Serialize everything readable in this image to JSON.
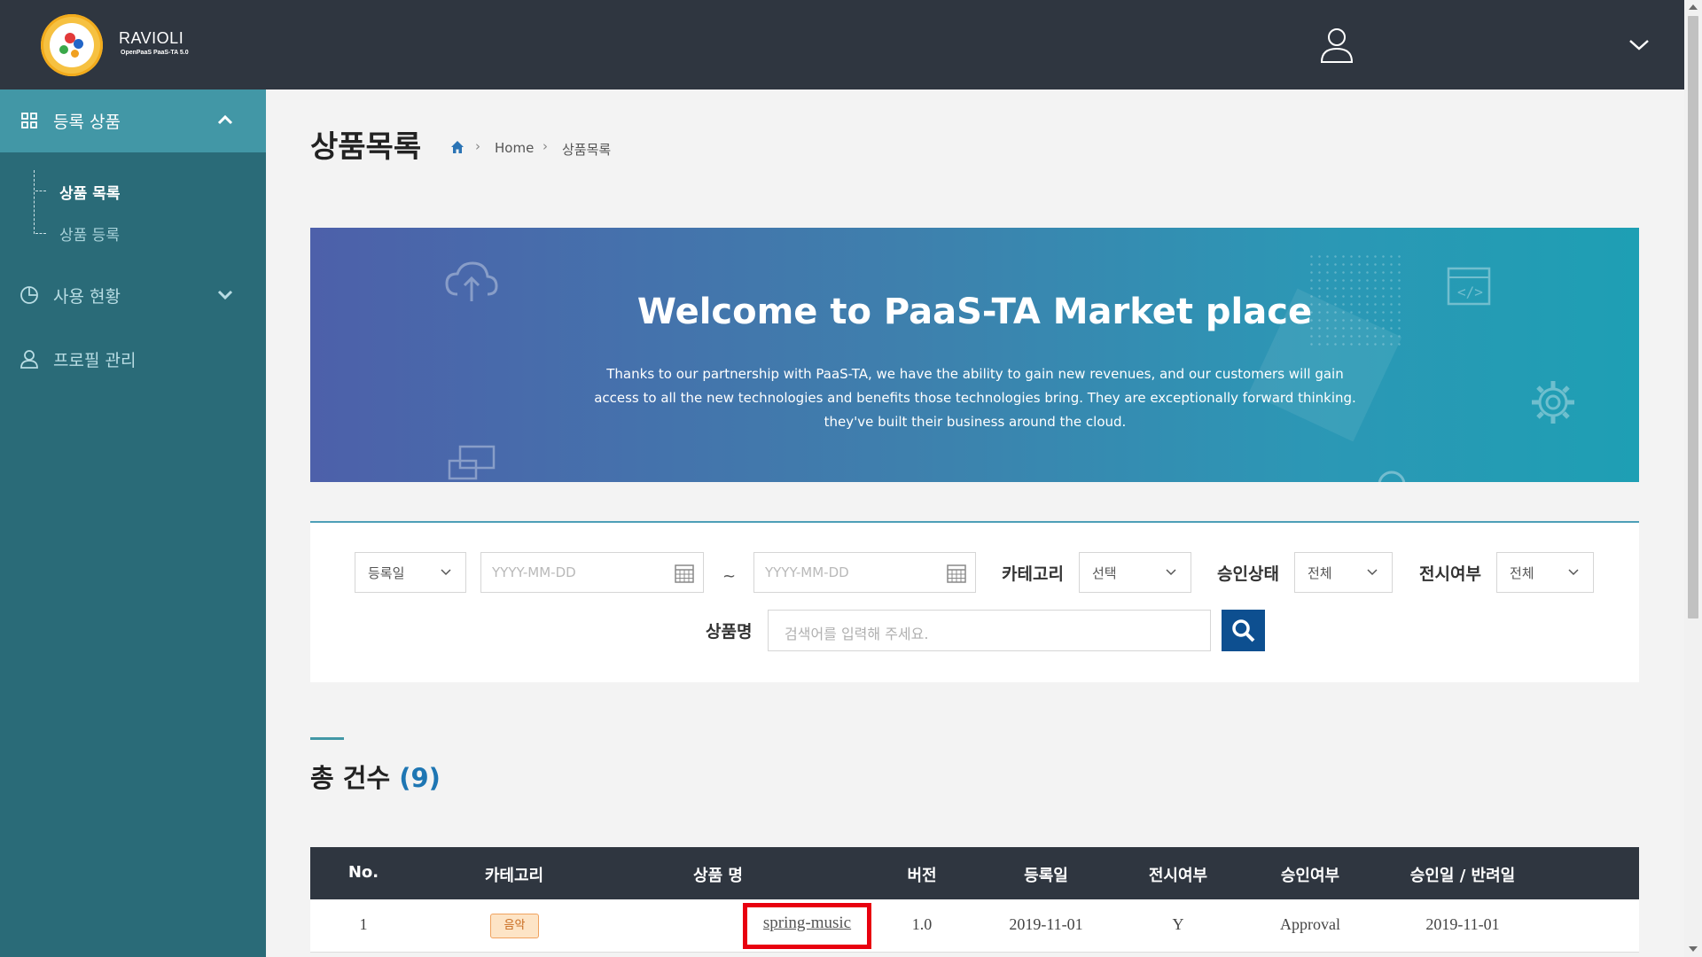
{
  "app": {
    "logo_text": "RAVIOLI",
    "logo_sub": "OpenPaaS PaaS-TA 5.0"
  },
  "sidebar": {
    "sections": [
      {
        "label": "등록 상품",
        "expanded": true,
        "icon": "grid-icon"
      },
      {
        "label": "사용 현황",
        "expanded": false,
        "icon": "chart-pie-icon"
      },
      {
        "label": "프로필 관리",
        "icon": "user-icon"
      }
    ],
    "sub_items": [
      {
        "label": "상품 목록",
        "active": true
      },
      {
        "label": "상품 등록",
        "active": false
      }
    ]
  },
  "header": {
    "title": "상품목록",
    "breadcrumb": [
      "Home",
      "상품목록"
    ]
  },
  "banner": {
    "title": "Welcome to PaaS-TA Market place",
    "lines": [
      "Thanks to our partnership with PaaS-TA, we have the ability to gain new revenues, and our customers will gain",
      "access to all the new technologies and benefits those technologies bring. They are exceptionally forward thinking.",
      "they've built their business around the cloud."
    ]
  },
  "search": {
    "date_type": "등록일",
    "date_from_placeholder": "YYYY-MM-DD",
    "tilde": "~",
    "date_to_placeholder": "YYYY-MM-DD",
    "category_label": "카테고리",
    "category_value": "선택",
    "approval_label": "승인상태",
    "approval_value": "전체",
    "display_label": "전시여부",
    "display_value": "전체",
    "name_label": "상품명",
    "name_placeholder": "검색어를 입력해 주세요."
  },
  "summary": {
    "label": "총 건수",
    "count": "(9)"
  },
  "table": {
    "columns": [
      "No.",
      "카테고리",
      "상품 명",
      "버전",
      "등록일",
      "전시여부",
      "승인여부",
      "승인일 / 반려일"
    ],
    "rows": [
      {
        "no": "1",
        "category": "음악",
        "name": "spring-music",
        "version": "1.0",
        "registered": "2019-11-01",
        "display": "Y",
        "approval": "Approval",
        "approved_date": "2019-11-01"
      }
    ]
  },
  "colors": {
    "topbar": "#2f3640",
    "sidebar": "#2a6b78",
    "sidebar_active": "#4297a6",
    "accent": "#1e76b3",
    "highlight": "#e8000f"
  }
}
